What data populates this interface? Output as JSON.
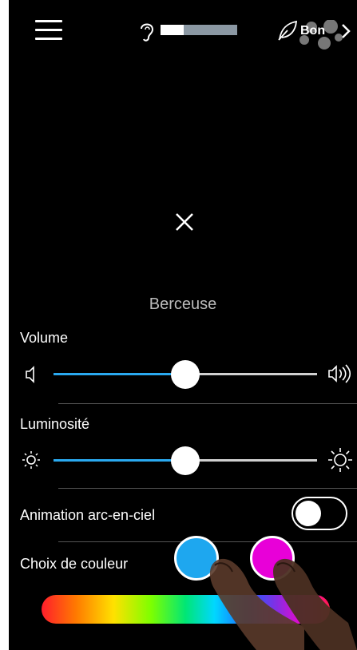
{
  "header": {
    "hearing_level": 0.3,
    "air_quality_label": "Bon"
  },
  "main": {
    "preset_name": "Berceuse"
  },
  "volume": {
    "label": "Volume",
    "level": 0.5
  },
  "brightness": {
    "label": "Luminosité",
    "level": 0.5
  },
  "rainbow_animation": {
    "label": "Animation arc-en-ciel",
    "enabled": false
  },
  "color_choice": {
    "label": "Choix de couleur",
    "swatches": [
      "#1ea7ef",
      "#e800d8"
    ]
  },
  "colors": {
    "accent": "#2aa9f0",
    "background": "#000000",
    "hearing_bar_track": "#8b98a3"
  }
}
